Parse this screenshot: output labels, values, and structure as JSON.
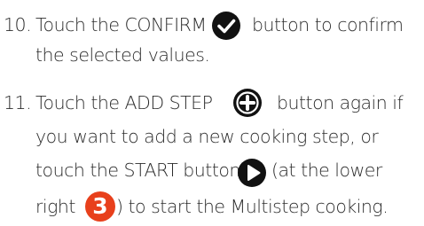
{
  "steps": [
    {
      "number": "10.",
      "line1_a": "Touch the CONFIRM",
      "line1_b": "button to confirm",
      "line2": "the selected values."
    },
    {
      "number": "11.",
      "line1_a": "Touch the ADD STEP",
      "line1_b": "button again if",
      "line2": "you want to add a new cooking step, or",
      "line3_a": "touch the START button",
      "line3_b": "(at the lower",
      "line4_a": "right",
      "line4_b": ") to start the Multistep cooking.",
      "badge": "3"
    }
  ],
  "icons": {
    "confirm": "check-circle-icon",
    "add_step": "plus-circle-icon",
    "start": "play-icon"
  },
  "colors": {
    "text": "#2b2b2b",
    "icon": "#111111",
    "badge": "#e8401c"
  }
}
